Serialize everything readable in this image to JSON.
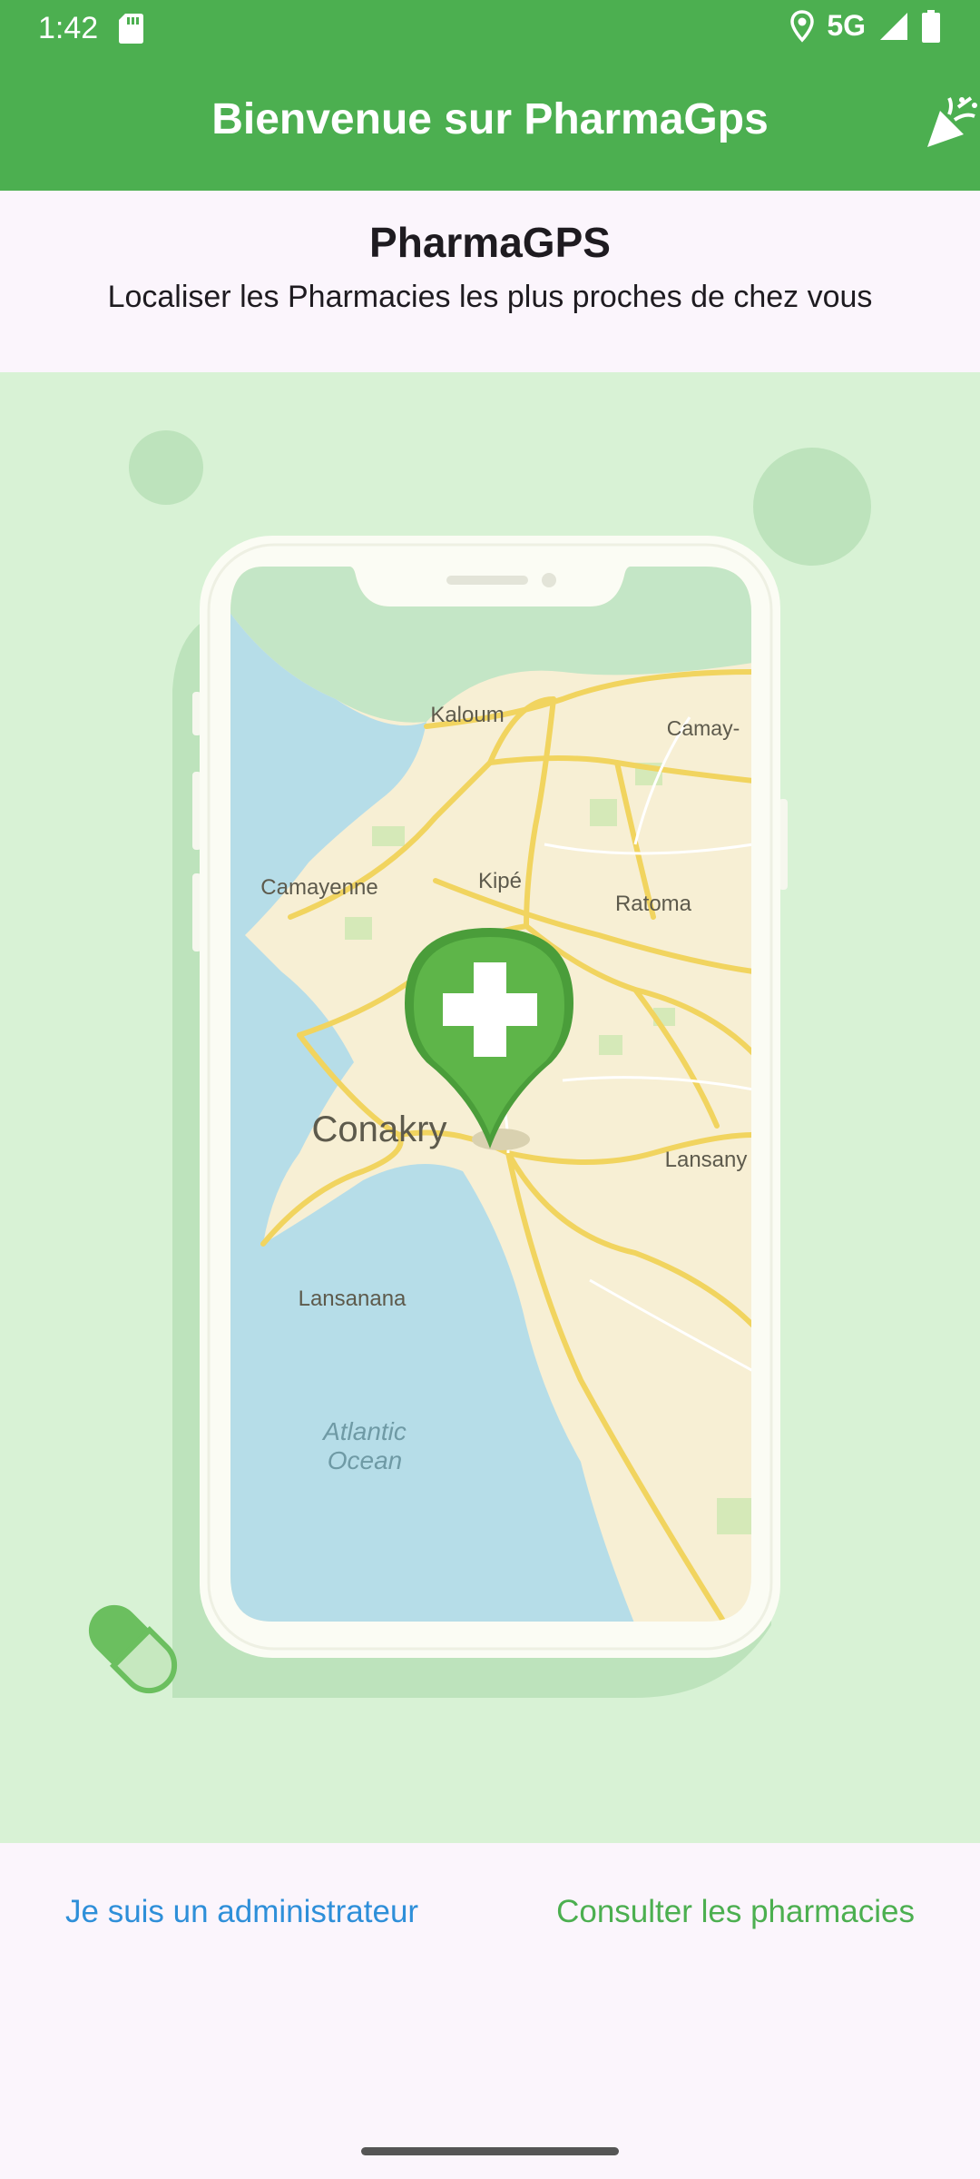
{
  "status": {
    "time": "1:42",
    "network": "5G"
  },
  "appbar": {
    "title": "Bienvenue sur PharmaGps",
    "action_icon": "celebration-icon"
  },
  "intro": {
    "app_name": "PharmaGPS",
    "tagline": "Localiser les Pharmacies les plus proches de chez vous"
  },
  "map": {
    "labels": {
      "kaloum": "Kaloum",
      "camayenne": "Camayenne",
      "kipe": "Kipé",
      "ratoma": "Ratoma",
      "camay": "Camay-",
      "conakry": "Conakry",
      "lansany": "Lansany",
      "lansanana": "Lansanana",
      "ocean_1": "Atlantic",
      "ocean_2": "Ocean"
    }
  },
  "actions": {
    "admin_label": "Je suis un administrateur",
    "consult_label": "Consulter les pharmacies"
  },
  "colors": {
    "primary": "#4caf50",
    "link_blue": "#2e8fd9",
    "hero_bg": "#d8f2d5"
  }
}
